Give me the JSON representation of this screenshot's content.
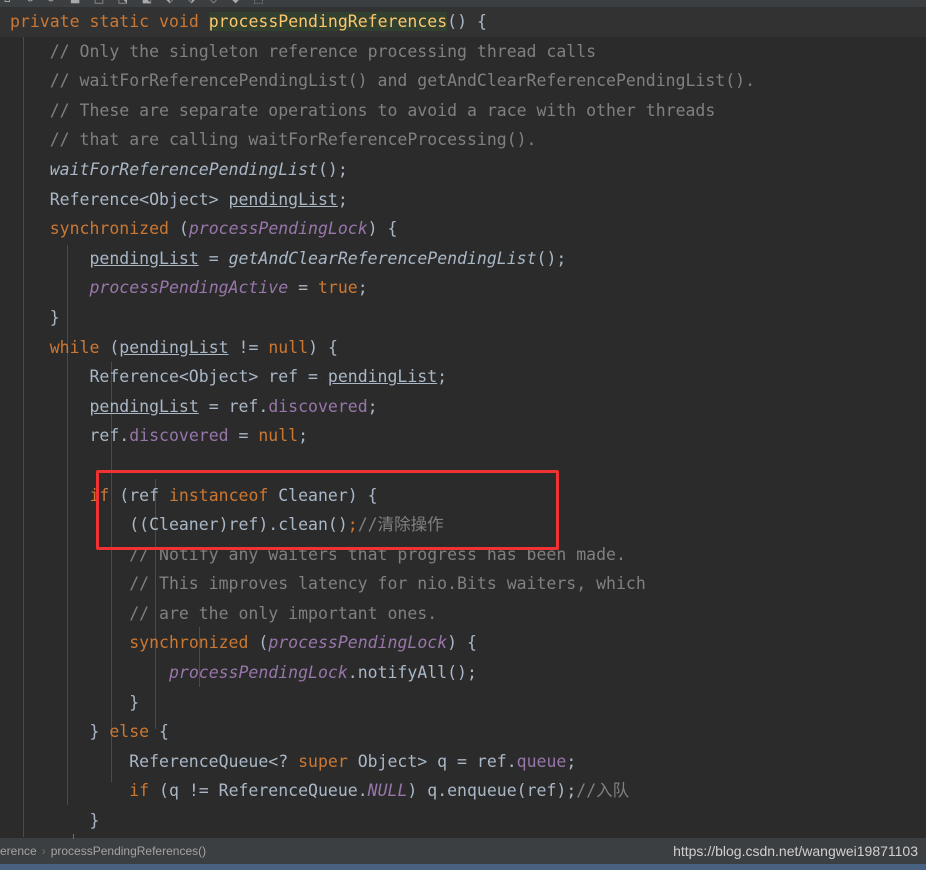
{
  "app": {
    "theme": "darcula",
    "background": "#2b2b2b",
    "current_line_background": "#323232",
    "accent": "#4a6282",
    "annotation_color": "#f03232"
  },
  "toolbar": {
    "icons_row": "⌂ ⟲ ⟳ ⬓ ⬒ ⬔ ⬕ ⬖ ⬗ ⬘ ⬙ ⬚"
  },
  "annotation": {
    "name": "red-highlight-box",
    "color": "#f03232",
    "covers_lines": [
      "if (ref instanceof Cleaner) {",
      "((Cleaner)ref).clean();//清除操作"
    ]
  },
  "editor": {
    "language": "java",
    "lines": [
      {
        "current": true,
        "tokens": [
          {
            "t": "kw",
            "s": "private"
          },
          {
            "t": "txt",
            "s": " "
          },
          {
            "t": "kw",
            "s": "static"
          },
          {
            "t": "txt",
            "s": " "
          },
          {
            "t": "kw",
            "s": "void"
          },
          {
            "t": "txt",
            "s": " "
          },
          {
            "t": "mdecl",
            "s": "processPendingReferences"
          },
          {
            "t": "txt",
            "s": "() {"
          }
        ]
      },
      {
        "tokens": [
          {
            "t": "cmt",
            "s": "    // Only the singleton reference processing thread calls"
          }
        ]
      },
      {
        "tokens": [
          {
            "t": "cmt",
            "s": "    // waitForReferencePendingList() and getAndClearReferencePendingList()."
          }
        ]
      },
      {
        "tokens": [
          {
            "t": "cmt",
            "s": "    // These are separate operations to avoid a race with other threads"
          }
        ]
      },
      {
        "tokens": [
          {
            "t": "cmt",
            "s": "    // that are calling waitForReferenceProcessing()."
          }
        ]
      },
      {
        "tokens": [
          {
            "t": "txt",
            "s": "    "
          },
          {
            "t": "stm",
            "s": "waitForReferencePendingList"
          },
          {
            "t": "txt",
            "s": "();"
          }
        ]
      },
      {
        "tokens": [
          {
            "t": "txt",
            "s": "    Reference<Object> "
          },
          {
            "t": "loc",
            "s": "pendingList"
          },
          {
            "t": "txt",
            "s": ";"
          }
        ]
      },
      {
        "tokens": [
          {
            "t": "txt",
            "s": "    "
          },
          {
            "t": "kw",
            "s": "synchronized"
          },
          {
            "t": "txt",
            "s": " ("
          },
          {
            "t": "sfld",
            "s": "processPendingLock"
          },
          {
            "t": "txt",
            "s": ") {"
          }
        ]
      },
      {
        "tokens": [
          {
            "t": "txt",
            "s": "        "
          },
          {
            "t": "loc",
            "s": "pendingList"
          },
          {
            "t": "txt",
            "s": " = "
          },
          {
            "t": "stm",
            "s": "getAndClearReferencePendingList"
          },
          {
            "t": "txt",
            "s": "();"
          }
        ]
      },
      {
        "tokens": [
          {
            "t": "txt",
            "s": "        "
          },
          {
            "t": "sfld",
            "s": "processPendingActive"
          },
          {
            "t": "txt",
            "s": " = "
          },
          {
            "t": "kw",
            "s": "true"
          },
          {
            "t": "txt",
            "s": ";"
          }
        ]
      },
      {
        "tokens": [
          {
            "t": "txt",
            "s": "    }"
          }
        ]
      },
      {
        "tokens": [
          {
            "t": "txt",
            "s": "    "
          },
          {
            "t": "kw",
            "s": "while"
          },
          {
            "t": "txt",
            "s": " ("
          },
          {
            "t": "loc",
            "s": "pendingList"
          },
          {
            "t": "txt",
            "s": " != "
          },
          {
            "t": "kw",
            "s": "null"
          },
          {
            "t": "txt",
            "s": ") {"
          }
        ]
      },
      {
        "tokens": [
          {
            "t": "txt",
            "s": "        Reference<Object> ref = "
          },
          {
            "t": "loc",
            "s": "pendingList"
          },
          {
            "t": "txt",
            "s": ";"
          }
        ]
      },
      {
        "tokens": [
          {
            "t": "txt",
            "s": "        "
          },
          {
            "t": "loc",
            "s": "pendingList"
          },
          {
            "t": "txt",
            "s": " = ref."
          },
          {
            "t": "fld",
            "s": "discovered"
          },
          {
            "t": "txt",
            "s": ";"
          }
        ]
      },
      {
        "tokens": [
          {
            "t": "txt",
            "s": "        ref."
          },
          {
            "t": "fld",
            "s": "discovered"
          },
          {
            "t": "txt",
            "s": " = "
          },
          {
            "t": "kw",
            "s": "null"
          },
          {
            "t": "txt",
            "s": ";"
          }
        ]
      },
      {
        "tokens": []
      },
      {
        "tokens": [
          {
            "t": "txt",
            "s": "        "
          },
          {
            "t": "kw",
            "s": "if"
          },
          {
            "t": "txt",
            "s": " (ref "
          },
          {
            "t": "kw",
            "s": "instanceof"
          },
          {
            "t": "txt",
            "s": " Cleaner) {"
          }
        ]
      },
      {
        "tokens": [
          {
            "t": "txt",
            "s": "            ((Cleaner)ref).clean()"
          },
          {
            "t": "kw",
            "s": ";"
          },
          {
            "t": "cmt",
            "s": "//清除操作"
          }
        ]
      },
      {
        "tokens": [
          {
            "t": "cmt",
            "s": "            // Notify any waiters that progress has been made."
          }
        ]
      },
      {
        "tokens": [
          {
            "t": "cmt",
            "s": "            // This improves latency for nio.Bits waiters, which"
          }
        ]
      },
      {
        "tokens": [
          {
            "t": "cmt",
            "s": "            // are the only important ones."
          }
        ]
      },
      {
        "tokens": [
          {
            "t": "txt",
            "s": "            "
          },
          {
            "t": "kw",
            "s": "synchronized"
          },
          {
            "t": "txt",
            "s": " ("
          },
          {
            "t": "sfld",
            "s": "processPendingLock"
          },
          {
            "t": "txt",
            "s": ") {"
          }
        ]
      },
      {
        "tokens": [
          {
            "t": "txt",
            "s": "                "
          },
          {
            "t": "sfld",
            "s": "processPendingLock"
          },
          {
            "t": "txt",
            "s": ".notifyAll();"
          }
        ]
      },
      {
        "tokens": [
          {
            "t": "txt",
            "s": "            }"
          }
        ]
      },
      {
        "tokens": [
          {
            "t": "txt",
            "s": "        } "
          },
          {
            "t": "kw",
            "s": "else"
          },
          {
            "t": "txt",
            "s": " {"
          }
        ]
      },
      {
        "tokens": [
          {
            "t": "txt",
            "s": "            ReferenceQueue<? "
          },
          {
            "t": "kw",
            "s": "super"
          },
          {
            "t": "txt",
            "s": " Object> q = ref."
          },
          {
            "t": "fld",
            "s": "queue"
          },
          {
            "t": "txt",
            "s": ";"
          }
        ]
      },
      {
        "tokens": [
          {
            "t": "txt",
            "s": "            "
          },
          {
            "t": "kw",
            "s": "if"
          },
          {
            "t": "txt",
            "s": " (q != ReferenceQueue."
          },
          {
            "t": "sfld",
            "s": "NULL"
          },
          {
            "t": "txt",
            "s": ") q.enqueue(ref);"
          },
          {
            "t": "cmt",
            "s": "//入队"
          }
        ]
      },
      {
        "tokens": [
          {
            "t": "txt",
            "s": "        }"
          }
        ]
      },
      {
        "tokens": [
          {
            "t": "txt",
            "s": "    }"
          }
        ]
      }
    ]
  },
  "statusbar": {
    "breadcrumb": [
      {
        "label": "erence",
        "type": "crumb"
      },
      {
        "label": "›",
        "type": "sep"
      },
      {
        "label": "processPendingReferences()",
        "type": "crumb"
      }
    ],
    "watermark": "https://blog.csdn.net/wangwei19871103"
  }
}
